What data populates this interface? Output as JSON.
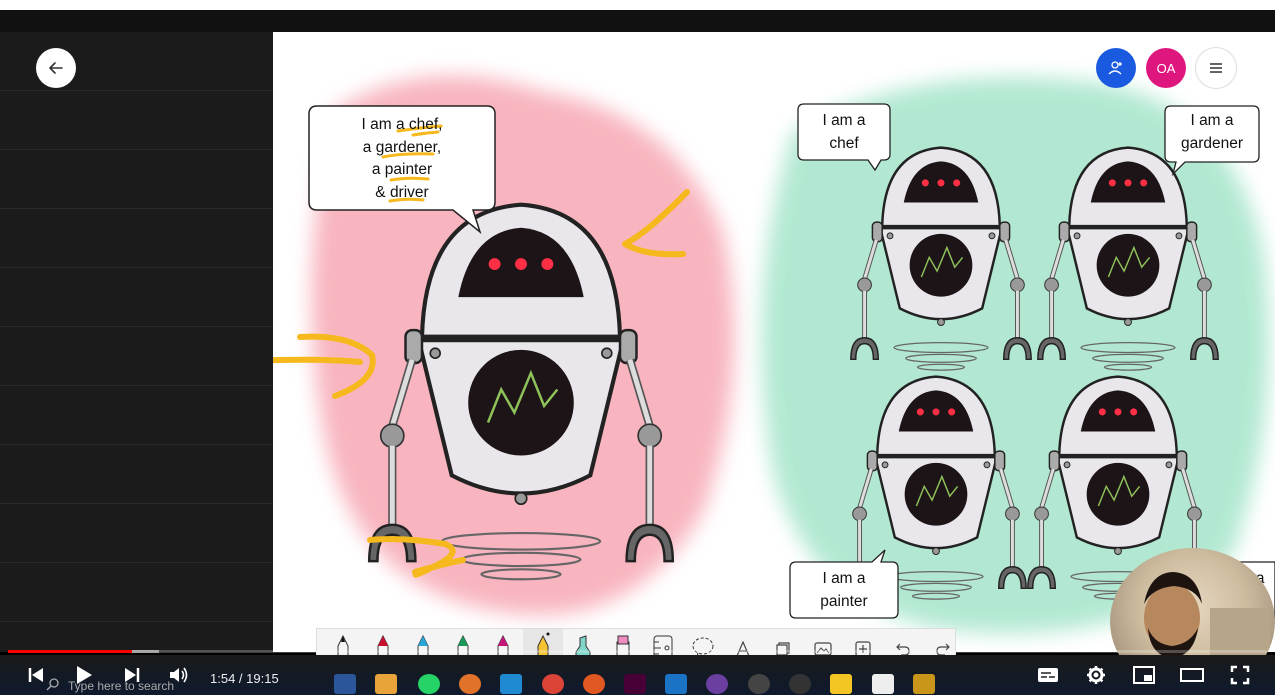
{
  "board": {
    "main_bubble": {
      "lines": [
        "I am a chef,",
        "a gardener,",
        "a painter",
        "& driver"
      ]
    },
    "small_bubbles": [
      {
        "lines": [
          "I am a",
          "chef"
        ]
      },
      {
        "lines": [
          "I am a",
          "gardener"
        ]
      },
      {
        "lines": [
          "I am a",
          "painter"
        ]
      },
      {
        "lines": [
          "I am a"
        ]
      }
    ],
    "blob_colors": {
      "pink": "#f7a8b4",
      "green": "#9fe3c6"
    },
    "highlight_color": "#f5b91d"
  },
  "top_right": {
    "invite_icon": "person-add-icon",
    "avatar_initials": "OA",
    "avatar_color": "#e0167f",
    "invite_color": "#1a5ae0",
    "menu_icon": "hamburger-icon"
  },
  "toolbar": {
    "tools": [
      "pencil-black-icon",
      "pencil-red-icon",
      "pencil-blue-icon",
      "pencil-green-icon",
      "pencil-magenta-icon",
      "pencil-yellow-icon",
      "highlighter-teal-icon",
      "highlighter-pink-icon",
      "ruler-icon",
      "lasso-icon",
      "text-icon",
      "shape-icon",
      "image-icon",
      "insert-icon",
      "undo-icon",
      "redo-icon"
    ]
  },
  "player": {
    "time_current": "1:54",
    "time_total": "19:15",
    "time_display": "1:54 / 19:15",
    "progress_played": 0.0987,
    "progress_buffered": 0.12,
    "search_placeholder": "Type here to search"
  }
}
